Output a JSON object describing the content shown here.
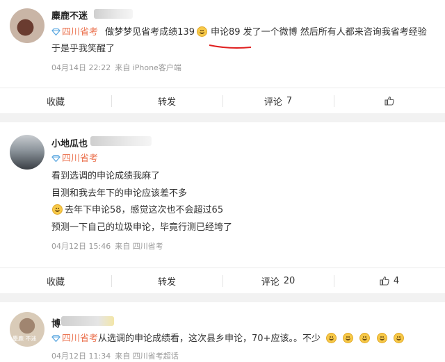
{
  "posts": [
    {
      "name": "麋鹿不迷",
      "source": "四川省考",
      "text": "做梦梦见省考成绩139",
      "text2": "申论89 发了一个微博 然后所有人都来咨询我省考经验",
      "text3": "于是乎我笑醒了",
      "time": "04月14日 22:22",
      "from": "来自 iPhone客户端",
      "actions": {
        "collect": "收藏",
        "repost": "转发",
        "comment": "评论",
        "comment_count": "7",
        "like_count": ""
      }
    },
    {
      "name": "小地瓜也",
      "source": "四川省考",
      "lines": [
        "看到选调的申论成绩我麻了",
        "目测和我去年下的申论应该差不多",
        "去年下申论58，感觉这次也不会超过65",
        "预测一下自己的垃圾申论，毕竟行测已经垮了"
      ],
      "time": "04月12日 15:46",
      "from": "来自 四川省考",
      "actions": {
        "collect": "收藏",
        "repost": "转发",
        "comment": "评论",
        "comment_count": "20",
        "like_count": "4"
      }
    },
    {
      "name": "博",
      "avatar_text": "麋鹿 不迷",
      "source": "四川省考",
      "text": "从选调的申论成绩看，这次县乡申论，70+应该。。不少",
      "time": "04月12日 11:34",
      "from": "来自 四川省考超话"
    }
  ],
  "icons": {
    "source": "diamond-icon",
    "like": "thumb-up-icon",
    "emoji": "grin-emoji"
  },
  "colors": {
    "source": "#eb7350",
    "annotation": "#e02020"
  }
}
